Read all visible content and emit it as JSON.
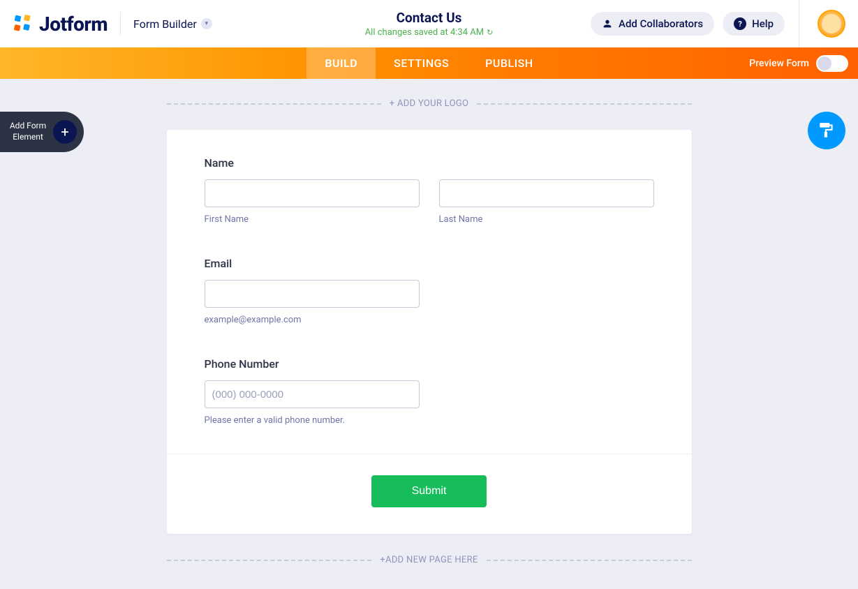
{
  "header": {
    "logo_text": "Jotform",
    "breadcrumb": "Form Builder",
    "form_title": "Contact Us",
    "save_status": "All changes saved at 4:34 AM",
    "collab_label": "Add Collaborators",
    "help_label": "Help"
  },
  "nav": {
    "tabs": [
      "BUILD",
      "SETTINGS",
      "PUBLISH"
    ],
    "preview_label": "Preview Form"
  },
  "side": {
    "add_element": "Add Form Element"
  },
  "stage": {
    "add_logo": "+ ADD YOUR LOGO",
    "add_page": "+ADD NEW PAGE HERE"
  },
  "form": {
    "name": {
      "label": "Name",
      "first_sub": "First Name",
      "last_sub": "Last Name"
    },
    "email": {
      "label": "Email",
      "sub": "example@example.com"
    },
    "phone": {
      "label": "Phone Number",
      "placeholder": "(000) 000-0000",
      "sub": "Please enter a valid phone number."
    },
    "submit": "Submit"
  }
}
